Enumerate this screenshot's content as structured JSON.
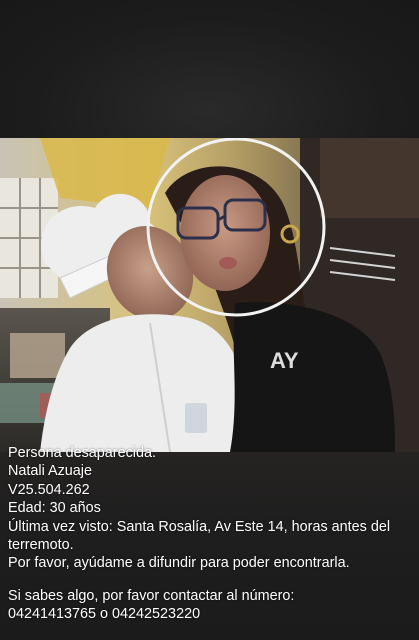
{
  "post": {
    "lines": [
      "Persona desaparecida.",
      "Natali Azuaje",
      "V25.504.262",
      "Edad: 30 años",
      "Última vez visto: Santa Rosalía, Av Este 14, horas antes del terremoto.",
      "Por favor, ayúdame a difundir para poder encontrarla.",
      "Si sabes algo, por favor contactar al número:",
      "04241413765 o 04242523220"
    ]
  },
  "photo": {
    "description_icon": "photo-image",
    "colors": {
      "circle_outline": "#f2f2f2",
      "background_dark": "#1b1b1b"
    }
  }
}
